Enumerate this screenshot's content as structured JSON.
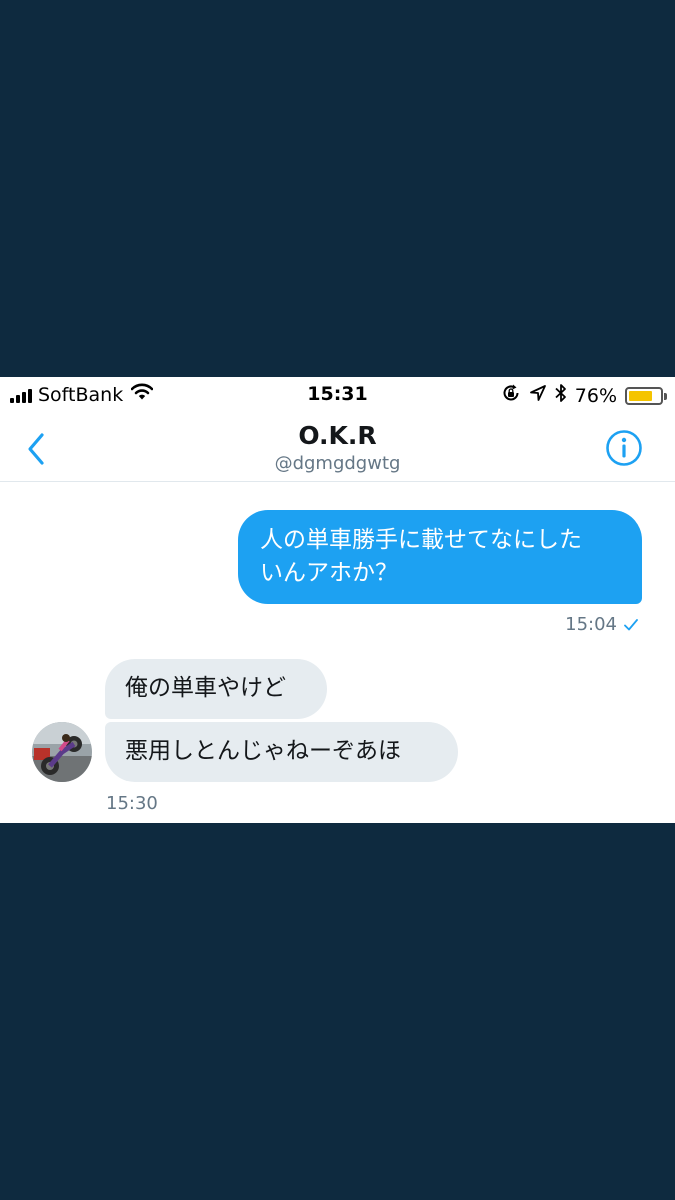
{
  "status_bar": {
    "carrier": "SoftBank",
    "time": "15:31",
    "battery_percent": "76%",
    "battery_level": 0.76
  },
  "header": {
    "name": "O.K.R",
    "handle": "@dgmgdgwtg"
  },
  "messages": [
    {
      "direction": "sent",
      "lines": [
        "人の単車勝手に載せてなにした",
        "いんアホか？"
      ],
      "time": "15:04",
      "read_icon": "check-icon"
    },
    {
      "direction": "received",
      "text": "俺の単車やけど"
    },
    {
      "direction": "received",
      "text": "悪用しとんじゃねーぞあほ",
      "time": "15:30"
    }
  ],
  "colors": {
    "accent": "#1da1f2",
    "background_outer": "#0e2a3f",
    "received_bubble": "#e6ecf0",
    "secondary_text": "#657786",
    "battery": "#f5c400"
  },
  "icons": [
    "signal-icon",
    "wifi-icon",
    "rotation-lock-icon",
    "location-arrow-icon",
    "bluetooth-icon",
    "battery-icon",
    "back-chevron-icon",
    "info-icon",
    "check-icon"
  ]
}
